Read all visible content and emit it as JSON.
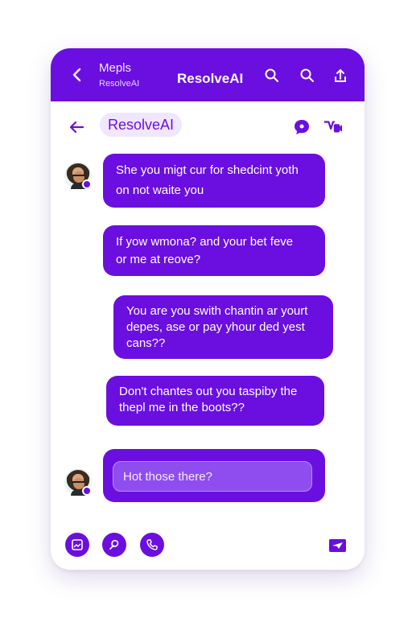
{
  "header": {
    "line1": "Mepls",
    "line2": "ResolveAI",
    "title": "ResolveAI",
    "icons": [
      "back-chevron-icon",
      "search-icon",
      "search-icon",
      "share-icon"
    ]
  },
  "subbar": {
    "chip_label": "ResolveAI",
    "icons": [
      "back-arrow-icon",
      "chat-bubble-icon",
      "video-icon"
    ]
  },
  "messages": [
    {
      "text_line1": "She you migt cur for shedcint yoth",
      "text_line2": "on not waite you"
    },
    {
      "text_line1": "If yow wmona? and your bet feve",
      "text_line2": "or me at reove?"
    },
    {
      "text_line1": "You are you swith chantin ar yourt",
      "text_line2": "depes, ase or pay yhour ded yest",
      "text_line3": "cans??"
    },
    {
      "text_line1": "Don't chantes out you taspiby the",
      "text_line2": "thepl me in the boots??"
    }
  ],
  "composer": {
    "placeholder": "Hot those there?"
  },
  "bottom_bar": {
    "icons": [
      "image-icon",
      "sticker-icon",
      "phone-icon",
      "send-icon"
    ]
  },
  "colors": {
    "accent": "#6a0fe0",
    "chip_bg": "#f1e6ff",
    "card_bg": "#ffffff"
  }
}
